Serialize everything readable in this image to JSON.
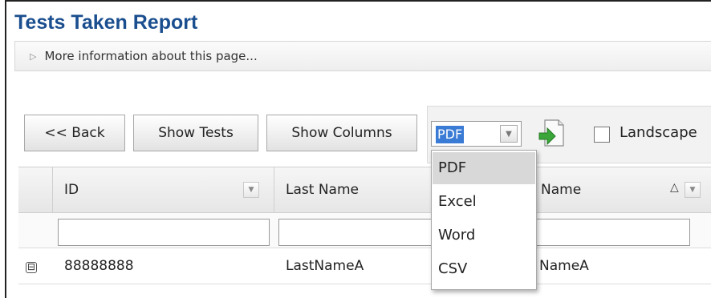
{
  "page": {
    "title": "Tests Taken Report",
    "info_link": "More information about this page..."
  },
  "toolbar": {
    "back_label": "<< Back",
    "show_tests_label": "Show Tests",
    "show_columns_label": "Show Columns",
    "export_format": {
      "selected": "PDF",
      "options": [
        "PDF",
        "Excel",
        "Word",
        "CSV"
      ],
      "open": true
    },
    "export_icon": "export-document-icon",
    "landscape_label": "Landscape",
    "landscape_checked": false
  },
  "grid": {
    "columns": [
      {
        "label": "ID",
        "sort": "",
        "menu": true
      },
      {
        "label": "Last Name",
        "sort": "",
        "menu": false
      },
      {
        "label": "Name",
        "sort": "△",
        "menu": true
      }
    ],
    "rows": [
      {
        "expander": "⊟",
        "id": "88888888",
        "last_name": "LastNameA",
        "name": "NameA"
      }
    ]
  },
  "colors": {
    "title": "#1a4e8f",
    "selection": "#3a7bd5",
    "dropdown_hover": "#d8d8d8"
  }
}
